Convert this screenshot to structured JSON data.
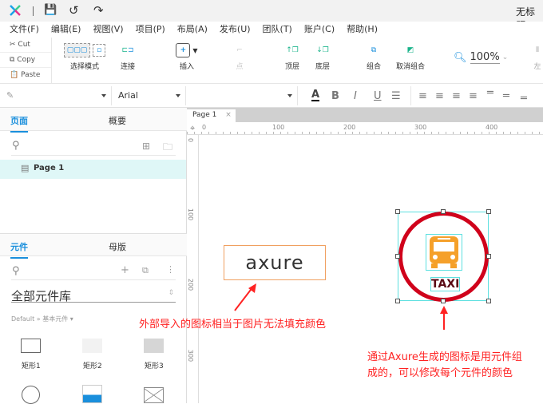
{
  "app": {
    "title": "无标题"
  },
  "menu": [
    "文件(F)",
    "编辑(E)",
    "视图(V)",
    "项目(P)",
    "布局(A)",
    "发布(U)",
    "团队(T)",
    "账户(C)",
    "帮助(H)"
  ],
  "clipboard": {
    "cut": "Cut",
    "copy": "Copy",
    "paste": "Paste"
  },
  "toolbar": {
    "select_mode": "选择模式",
    "connect": "连接",
    "insert": "插入",
    "point": "点",
    "top": "顶层",
    "bottom": "底层",
    "group": "组合",
    "ungroup": "取消组合",
    "zoom": "100%",
    "left": "左"
  },
  "format": {
    "font": "Arial",
    "bold": "B",
    "italic": "I",
    "underline": "U",
    "text_color": "A"
  },
  "pages_panel": {
    "tab_pages": "页面",
    "tab_outline": "概要",
    "page": "Page 1"
  },
  "widgets_panel": {
    "tab_widgets": "元件",
    "tab_masters": "母版",
    "library": "全部元件库",
    "breadcrumb": "Default » 基本元件 ▾",
    "items": [
      "矩形1",
      "矩形2",
      "矩形3"
    ]
  },
  "canvas": {
    "tab": "Page 1",
    "ruler_h": [
      "0",
      "100",
      "200",
      "300",
      "400"
    ],
    "ruler_v": [
      "0",
      "100",
      "200",
      "300"
    ],
    "logo": "axure",
    "taxi": "TAXI",
    "annot1": "外部导入的图标相当于图片无法填充颜色",
    "annot2_line1": "通过Axure生成的图标是用元件组",
    "annot2_line2": "成的，可以修改每个元件的颜色"
  },
  "colors": {
    "accent": "#1a8fdc",
    "annotation": "#ff2222",
    "taxi_ring": "#d0021b",
    "bus": "#f5a02a",
    "selection": "#5ee0e0"
  }
}
